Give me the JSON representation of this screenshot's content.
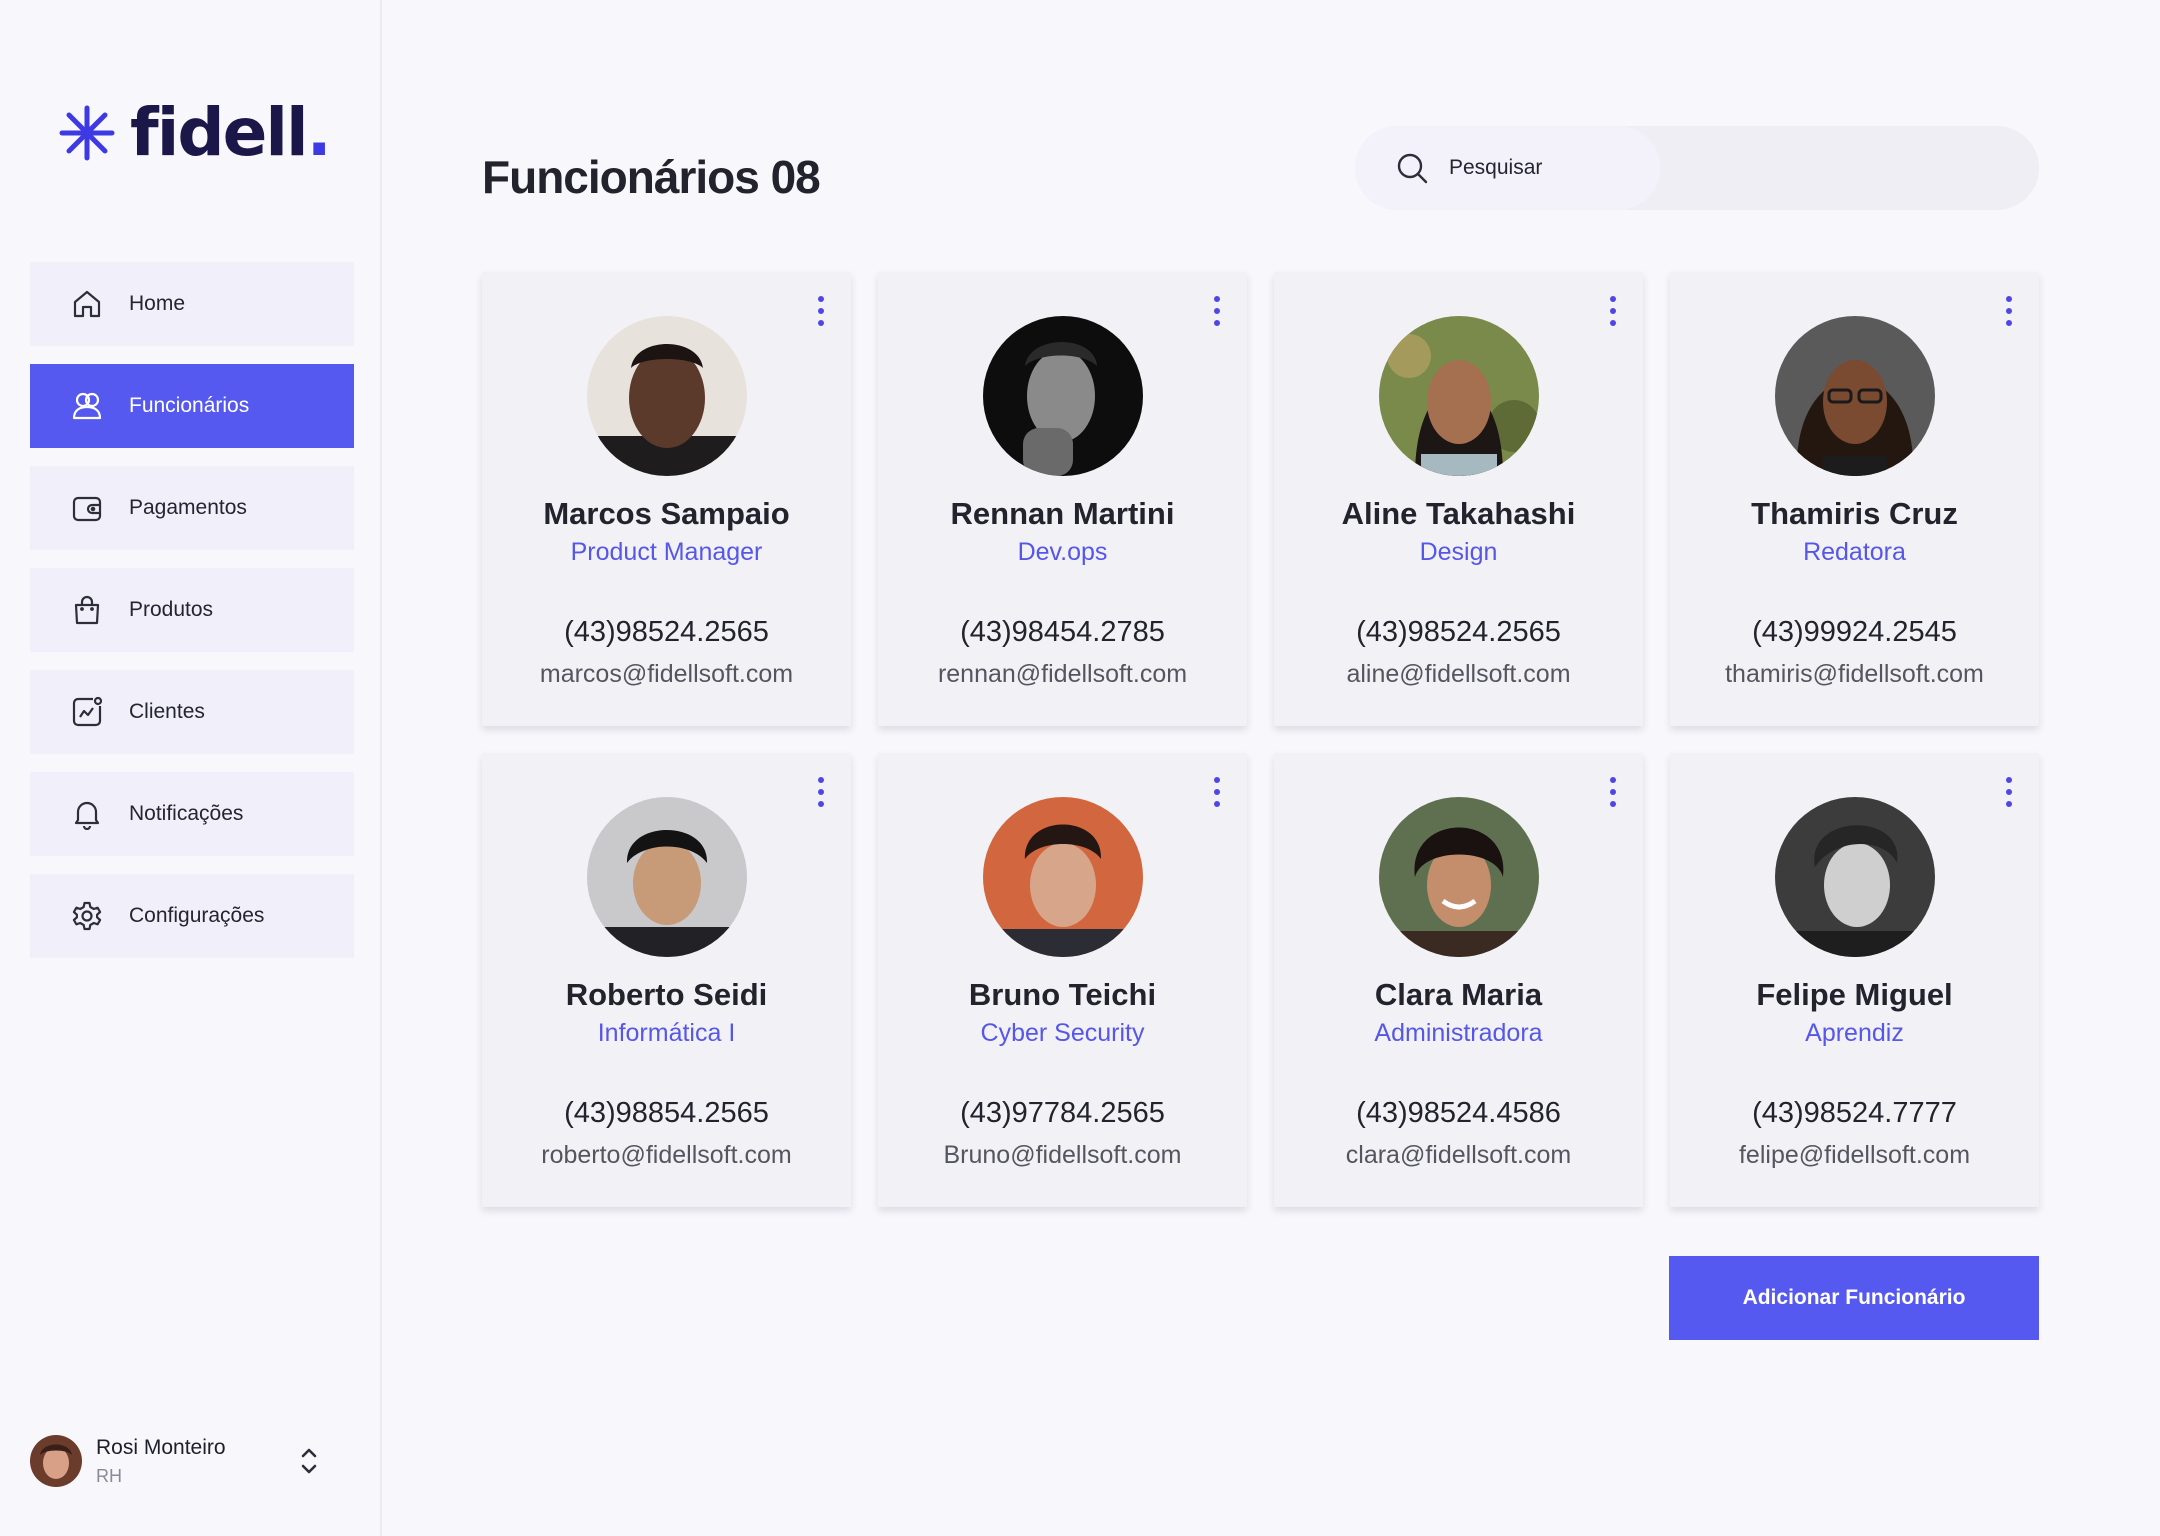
{
  "brand": {
    "name": "fidell",
    "dot": "."
  },
  "nav": {
    "items": [
      {
        "label": "Home",
        "icon": "home-icon",
        "active": false
      },
      {
        "label": "Funcionários",
        "icon": "users-icon",
        "active": true
      },
      {
        "label": "Pagamentos",
        "icon": "wallet-icon",
        "active": false
      },
      {
        "label": "Produtos",
        "icon": "shopping-bag-icon",
        "active": false
      },
      {
        "label": "Clientes",
        "icon": "chart-icon",
        "active": false
      },
      {
        "label": "Notificações",
        "icon": "bell-icon",
        "active": false
      },
      {
        "label": "Configurações",
        "icon": "gear-icon",
        "active": false
      }
    ]
  },
  "user": {
    "name": "Rosi Monteiro",
    "role": "RH"
  },
  "header": {
    "title": "Funcionários 08"
  },
  "search": {
    "placeholder": "Pesquisar"
  },
  "employees": [
    {
      "name": "Marcos Sampaio",
      "role": "Product Manager",
      "phone": "(43)98524.2565",
      "email": "marcos@fidellsoft.com"
    },
    {
      "name": "Rennan Martini",
      "role": "Dev.ops",
      "phone": "(43)98454.2785",
      "email": "rennan@fidellsoft.com"
    },
    {
      "name": "Aline Takahashi",
      "role": "Design",
      "phone": "(43)98524.2565",
      "email": "aline@fidellsoft.com"
    },
    {
      "name": "Thamiris Cruz",
      "role": "Redatora",
      "phone": "(43)99924.2545",
      "email": "thamiris@fidellsoft.com"
    },
    {
      "name": "Roberto Seidi",
      "role": "Informática I",
      "phone": "(43)98854.2565",
      "email": "roberto@fidellsoft.com"
    },
    {
      "name": "Bruno Teichi",
      "role": "Cyber Security",
      "phone": "(43)97784.2565",
      "email": "Bruno@fidellsoft.com"
    },
    {
      "name": "Clara Maria",
      "role": "Administradora",
      "phone": "(43)98524.4586",
      "email": "clara@fidellsoft.com"
    },
    {
      "name": "Felipe Miguel",
      "role": "Aprendiz",
      "phone": "(43)98524.7777",
      "email": "felipe@fidellsoft.com"
    }
  ],
  "actions": {
    "add_label": "Adicionar Funcionário"
  },
  "colors": {
    "accent": "#5659f0",
    "brand_dark": "#1b1748",
    "role_text": "#5656e8"
  }
}
